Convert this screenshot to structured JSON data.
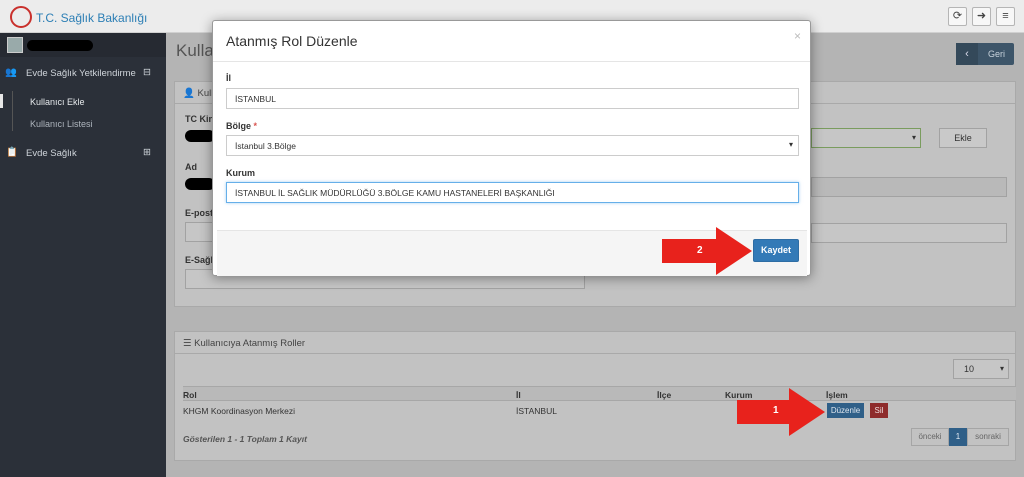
{
  "header": {
    "brand": "T.C. Sağlık Bakanlığı",
    "icons": [
      "refresh-icon",
      "logout-icon",
      "menu-icon"
    ]
  },
  "sidebar": {
    "section1": {
      "label": "Evde Sağlık Yetkilendirme",
      "toggle": "⊟"
    },
    "sub_items": [
      "Kullanıcı Ekle",
      "Kullanıcı Listesi"
    ],
    "section2": {
      "label": "Evde Sağlık",
      "toggle": "⊞"
    }
  },
  "main": {
    "page_title": "Kullan",
    "back_label": "Geri",
    "form_panel": {
      "title": "Kull",
      "labels": [
        "TC Kin",
        "Ad",
        "E-post",
        "E-Sağl"
      ],
      "add_button": "Ekle"
    },
    "roles_panel": {
      "title": "Kullanıcıya Atanmış Roller",
      "page_size": "10",
      "columns": [
        "Rol",
        "İl",
        "İlçe",
        "Kurum",
        "İşlem"
      ],
      "rows": [
        {
          "rol": "KHGM Koordinasyon Merkezi",
          "il": "İSTANBUL",
          "edit": "Düzenle",
          "delete": "Sil"
        }
      ],
      "summary": "Gösterilen 1 - 1 Toplam 1 Kayıt",
      "pagination": {
        "prev": "önceki",
        "current": "1",
        "next": "sonraki"
      }
    }
  },
  "modal": {
    "title": "Atanmış Rol Düzenle",
    "close": "×",
    "il_label": "İl",
    "il_value": "İSTANBUL",
    "bolge_label": "Bölge",
    "bolge_required": "*",
    "bolge_value": "İstanbul 3.Bölge",
    "kurum_label": "Kurum",
    "kurum_value": "İSTANBUL İL SAĞLIK MÜDÜRLÜĞÜ 3.BÖLGE KAMU HASTANELERİ BAŞKANLIĞI",
    "save_label": "Kaydet"
  },
  "annotations": {
    "arrow1": "1",
    "arrow2": "2",
    "color": "#e8221c"
  }
}
